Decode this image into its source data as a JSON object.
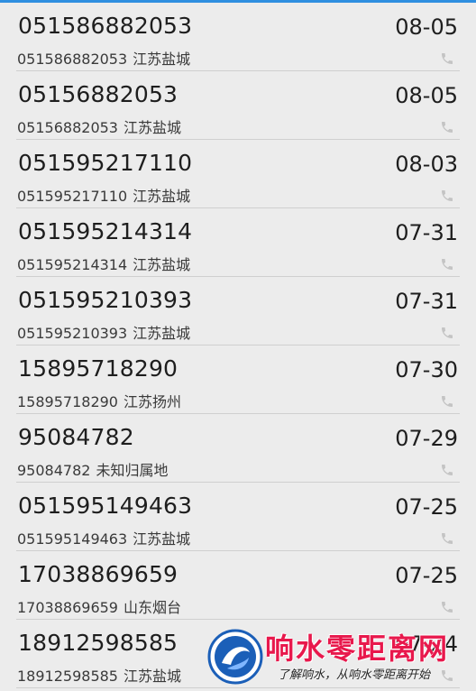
{
  "accent_color": "#2f8fe0",
  "call_log": [
    {
      "number": "051586882053",
      "detail_number": "051586882053",
      "location": "江苏盐城",
      "date": "08-05",
      "icon": "phone-icon"
    },
    {
      "number": "05156882053",
      "detail_number": "05156882053",
      "location": "江苏盐城",
      "date": "08-05",
      "icon": "phone-icon"
    },
    {
      "number": "051595217110",
      "detail_number": "051595217110",
      "location": "江苏盐城",
      "date": "08-03",
      "icon": "phone-icon"
    },
    {
      "number": "051595214314",
      "detail_number": "051595214314",
      "location": "江苏盐城",
      "date": "07-31",
      "icon": "phone-icon"
    },
    {
      "number": "051595210393",
      "detail_number": "051595210393",
      "location": "江苏盐城",
      "date": "07-31",
      "icon": "phone-icon"
    },
    {
      "number": "15895718290",
      "detail_number": "15895718290",
      "location": "江苏扬州",
      "date": "07-30",
      "icon": "phone-icon"
    },
    {
      "number": "95084782",
      "detail_number": "95084782",
      "location": "未知归属地",
      "date": "07-29",
      "icon": "phone-icon"
    },
    {
      "number": "051595149463",
      "detail_number": "051595149463",
      "location": "江苏盐城",
      "date": "07-25",
      "icon": "phone-icon"
    },
    {
      "number": "17038869659",
      "detail_number": "17038869659",
      "location": "山东烟台",
      "date": "07-25",
      "icon": "phone-icon"
    },
    {
      "number": "18912598585",
      "detail_number": "18912598585",
      "location": "江苏盐城",
      "date": "07-24",
      "icon": "phone-icon"
    }
  ],
  "watermark": {
    "title": "响水零距离网",
    "slogan": "了解响水，从响水零距离开始",
    "title_color": "#e8184c"
  }
}
